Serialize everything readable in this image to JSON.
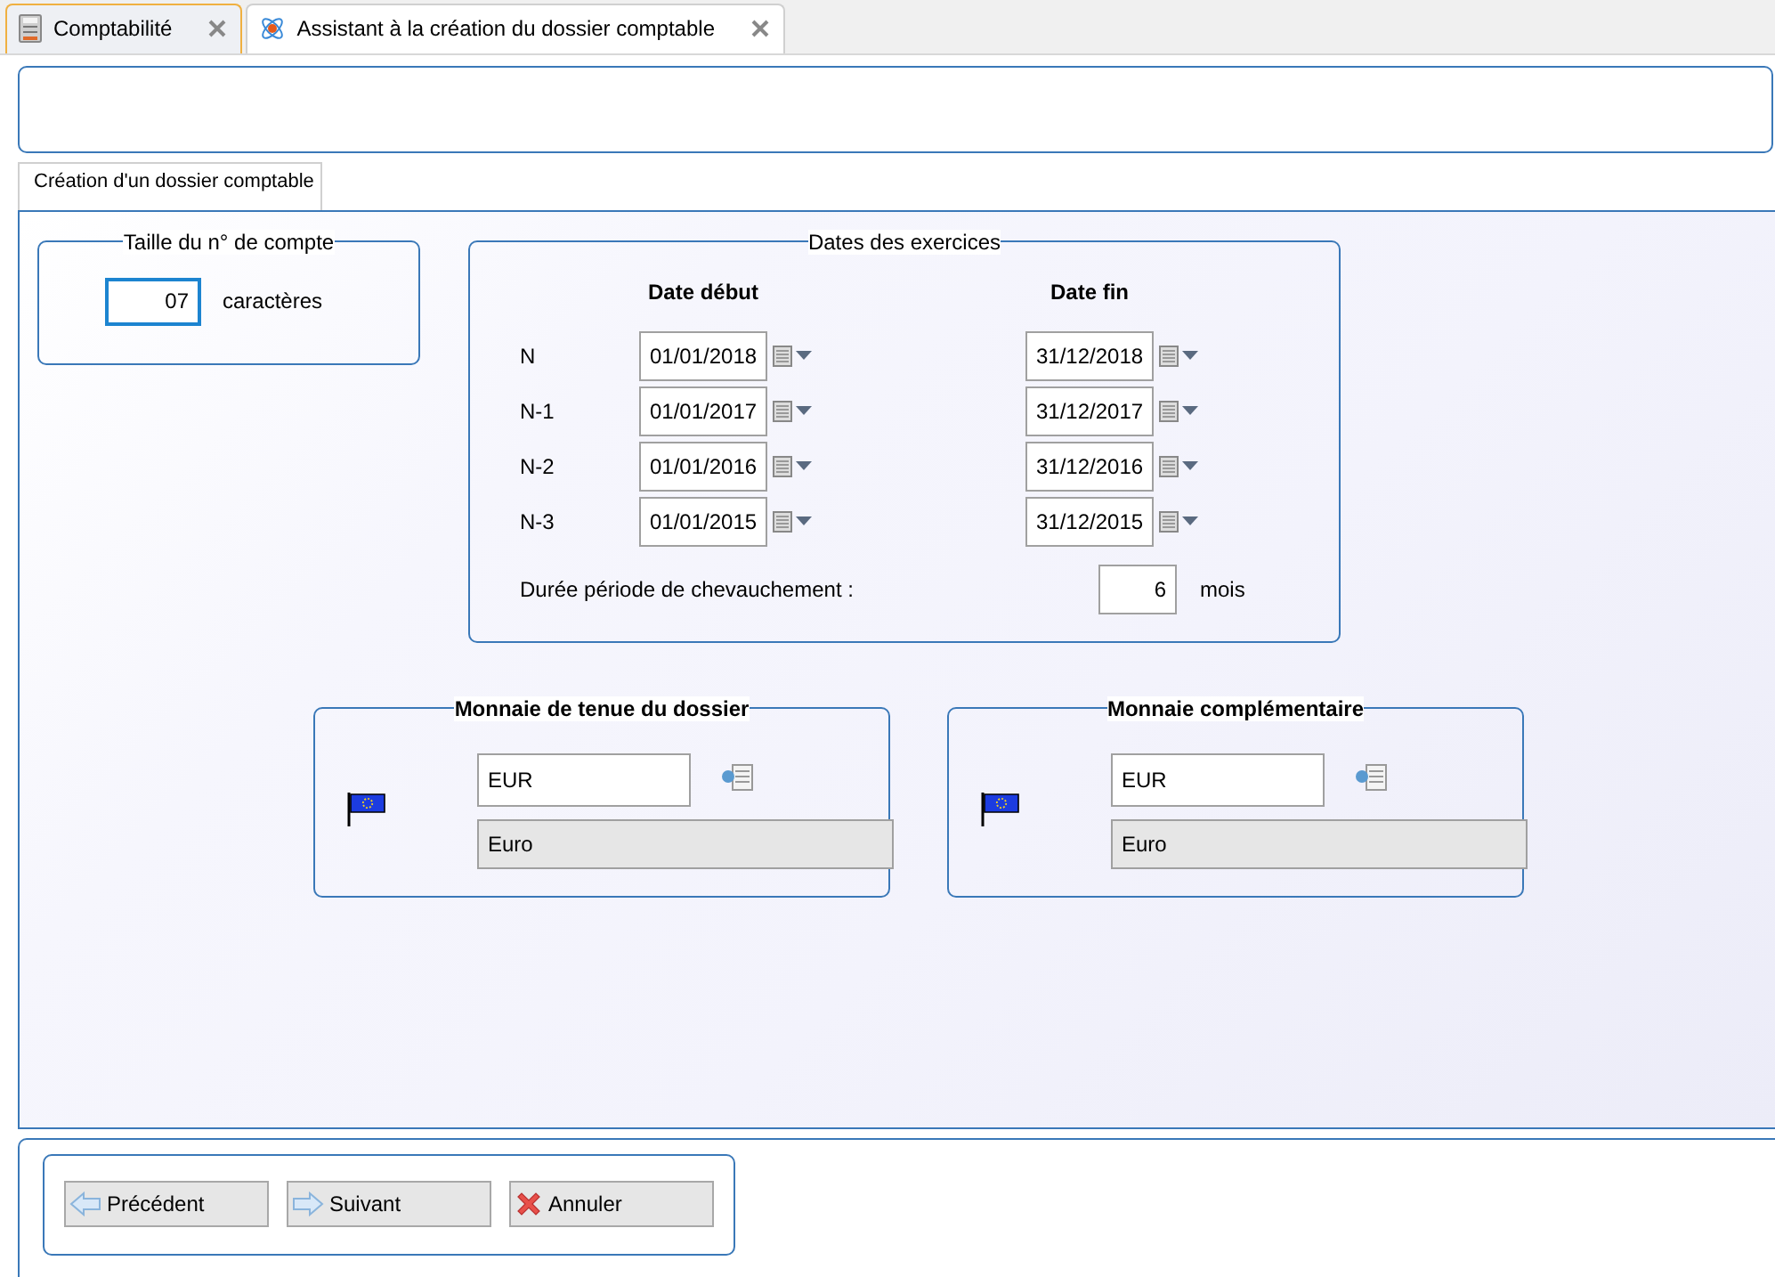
{
  "tabs": [
    {
      "label": "Comptabilité",
      "selected": false
    },
    {
      "label": "Assistant à la création du dossier comptable",
      "selected": true
    }
  ],
  "page_tab": {
    "label": "Création d'un dossier comptable",
    "selected": true
  },
  "account_size": {
    "title": "Taille du n° de compte",
    "value": "07",
    "unit": "caractères"
  },
  "dates": {
    "title": "Dates des exercices",
    "columns": [
      "Date début",
      "Date fin"
    ],
    "rows": [
      {
        "label": "N",
        "start": "01/01/2018",
        "end": "31/12/2018"
      },
      {
        "label": "N-1",
        "start": "01/01/2017",
        "end": "31/12/2017"
      },
      {
        "label": "N-2",
        "start": "01/01/2016",
        "end": "31/12/2016"
      },
      {
        "label": "N-3",
        "start": "01/01/2015",
        "end": "31/12/2015"
      }
    ],
    "overlap": {
      "label": "Durée période de chevauchement :",
      "value": "6",
      "unit": "mois"
    }
  },
  "currencies": [
    {
      "title": "Monnaie de tenue du dossier",
      "code": "EUR",
      "name": "Euro"
    },
    {
      "title": "Monnaie complémentaire",
      "code": "EUR",
      "name": "Euro"
    }
  ],
  "buttons": [
    {
      "label": "Précédent",
      "kind": "previous"
    },
    {
      "label": "Suivant",
      "kind": "next"
    },
    {
      "label": "Annuler",
      "kind": "cancel"
    }
  ]
}
